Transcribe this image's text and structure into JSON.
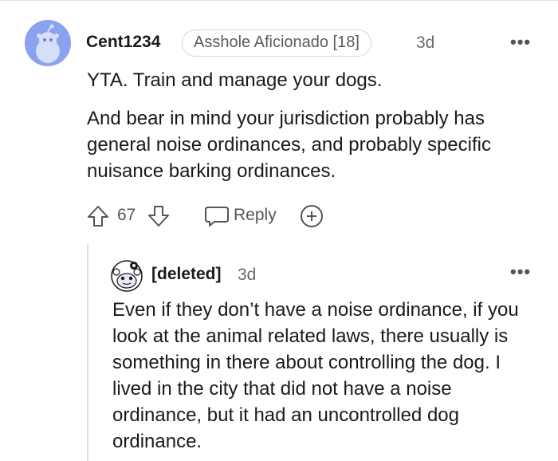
{
  "comment": {
    "username": "Cent1234",
    "flair": "Asshole Aficionado [18]",
    "age": "3d",
    "more_label": "•••",
    "paragraph1": "YTA. Train and manage your dogs.",
    "paragraph2": "And bear in mind your jurisdiction probably has general noise ordinances, and probably specific nuisance barking ordinances.",
    "votes": "67",
    "reply_label": "Reply"
  },
  "reply": {
    "username": "[deleted]",
    "age": "3d",
    "more_label": "•••",
    "text": "Even if they don’t have a noise ordinance, if you look at the animal related laws, there usually is something in there about controlling the dog. I lived in the city that did not have a noise ordinance, but it had an uncontrolled dog ordinance."
  },
  "icons": {
    "avatar1": "snoo-avatar-icon",
    "avatar2": "deleted-snoo-avatar-icon",
    "upvote": "upvote-arrow-icon",
    "downvote": "downvote-arrow-icon",
    "reply": "chat-bubble-icon",
    "award": "award-plus-icon",
    "more": "more-dots-icon"
  },
  "colors": {
    "avatar_bg": "#8ba2f0",
    "text": "#1a1a1b",
    "meta": "#6a6a6a",
    "thread_line": "#dcdcdc"
  }
}
